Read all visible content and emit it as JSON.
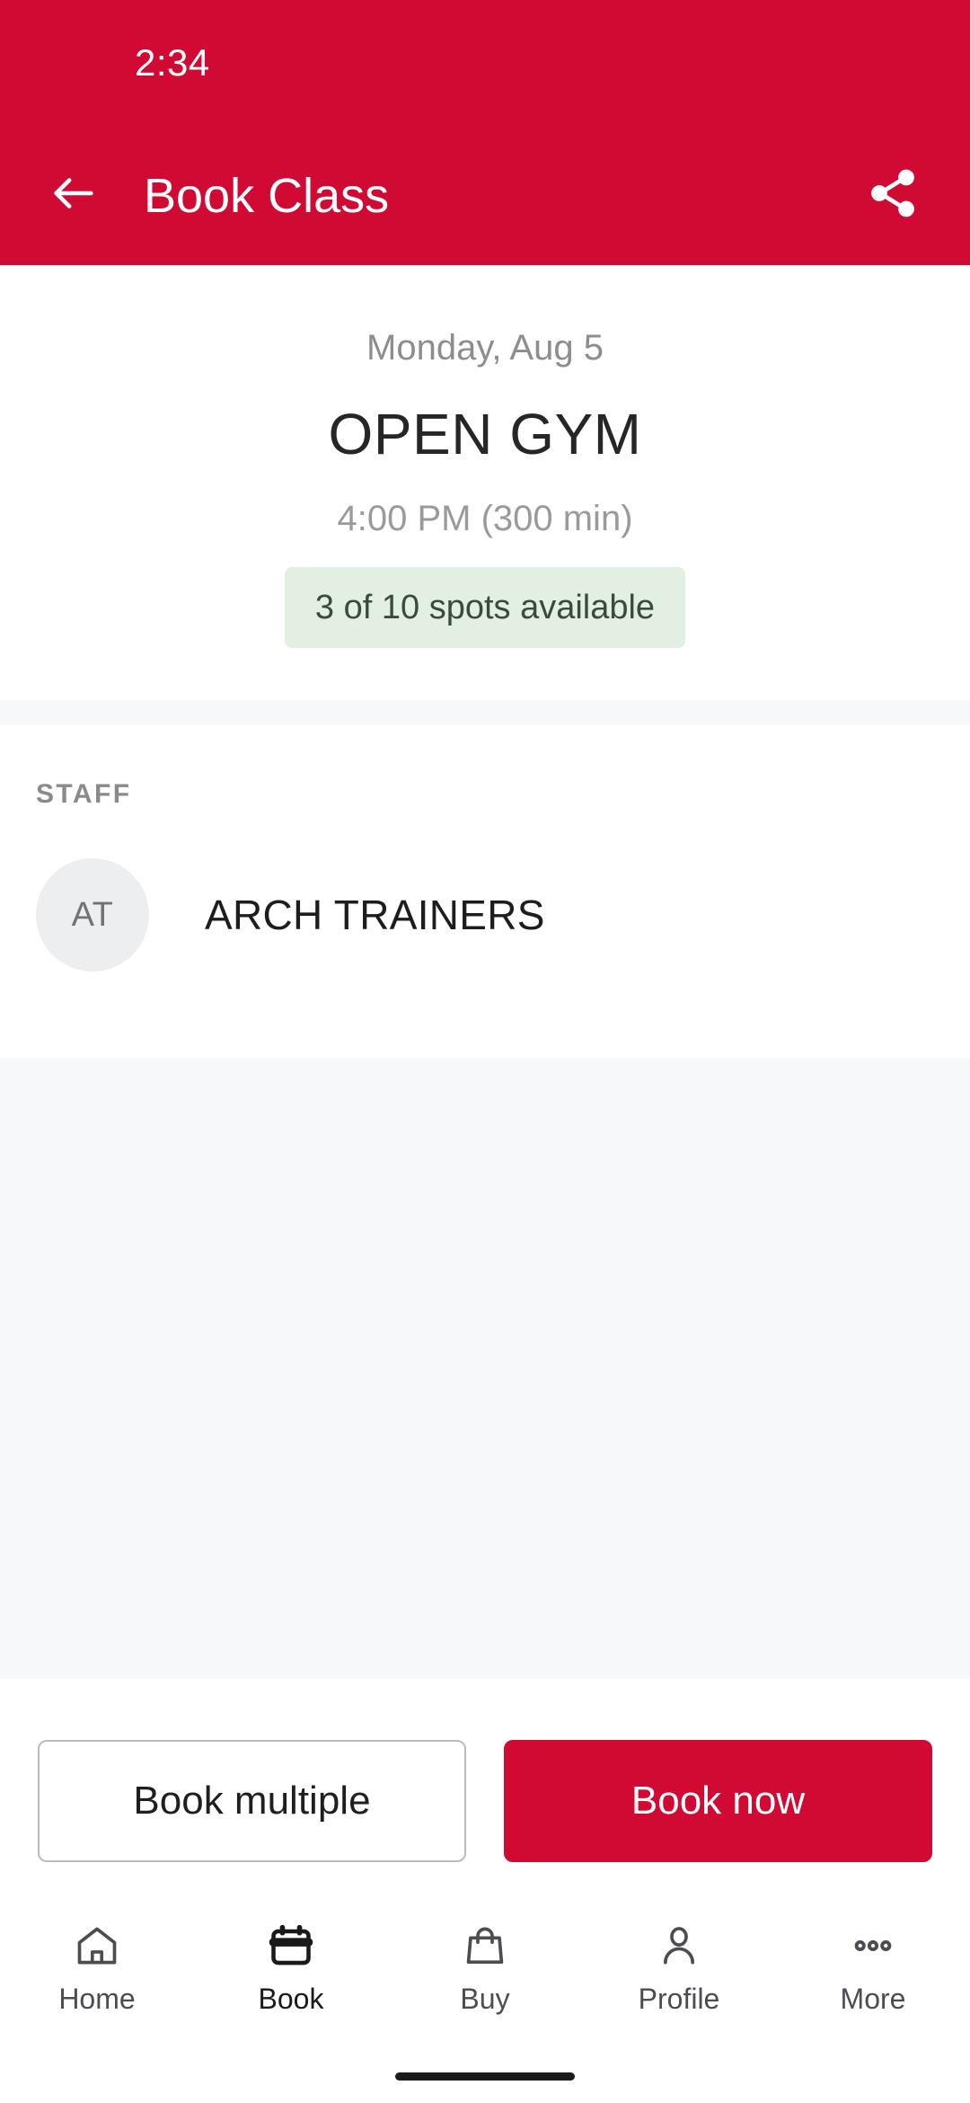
{
  "status_bar": {
    "clock": "2:34"
  },
  "app_bar": {
    "back_icon": "arrow-left-icon",
    "title": "Book Class",
    "share_icon": "share-icon"
  },
  "class_details": {
    "date": "Monday, Aug 5",
    "name": "OPEN GYM",
    "time": "4:00 PM (300 min)",
    "availability": "3 of 10 spots available",
    "availability_bg": "#E4EFE3",
    "availability_text_color": "#3a4a3c"
  },
  "staff_section": {
    "label": "STAFF",
    "members": [
      {
        "initials": "AT",
        "name": "ARCH TRAINERS"
      }
    ]
  },
  "actions": {
    "secondary_label": "Book multiple",
    "primary_label": "Book now",
    "primary_color": "#D00A33"
  },
  "bottom_nav": {
    "items": [
      {
        "label": "Home",
        "icon": "home-icon",
        "active": false
      },
      {
        "label": "Book",
        "icon": "calendar-icon",
        "active": true
      },
      {
        "label": "Buy",
        "icon": "shopping-bag-icon",
        "active": false
      },
      {
        "label": "Profile",
        "icon": "person-icon",
        "active": false
      },
      {
        "label": "More",
        "icon": "more-dots-icon",
        "active": false
      }
    ]
  },
  "theme": {
    "brand_red": "#D00A33",
    "surface_gray": "#F7F8FA"
  }
}
